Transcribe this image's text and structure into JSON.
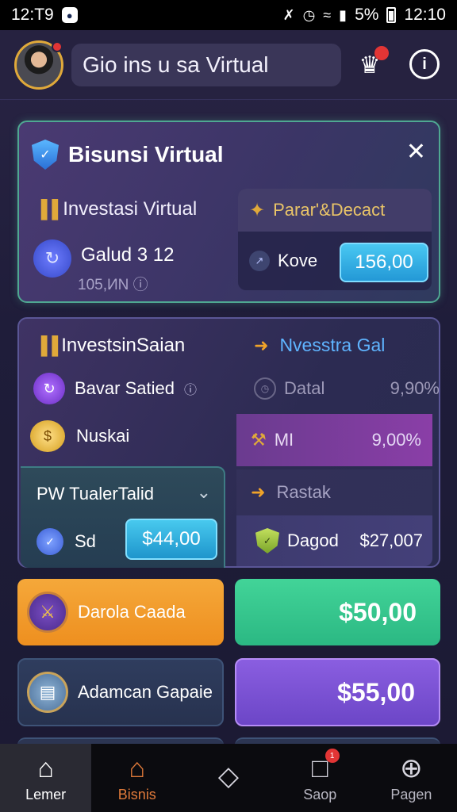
{
  "status_bar": {
    "left_time": "12:T9",
    "right_battery_pct": "5%",
    "right_time": "12:10"
  },
  "header": {
    "title": "Gio ins u sa Virtual",
    "icons": [
      "avatar",
      "trophy-icon",
      "info-icon"
    ]
  },
  "card1": {
    "title": "Bisunsi Virtual",
    "subtitle": "Investasi Virtual",
    "value_label": "Galud 3 12",
    "value_small": "105,ИN",
    "panel_title": "Parar'&Decact",
    "panel_row_label": "Kove",
    "panel_button": "156,00"
  },
  "card2": {
    "title_left": "InvestsinSaian",
    "title_right": "Nvesstra Gal",
    "row1_left": "Bavar Satied",
    "row1_right_label": "Datal",
    "row1_right_value": "9,90%",
    "row2_left": "Nuskai",
    "row2_right_label": "MI",
    "row2_right_value": "9,00%",
    "teal_title": "PW TualerTalid",
    "teal_row_label": "Sd",
    "teal_button": "$44,00",
    "row3_right_label": "Rastak",
    "row4_right_label": "Dagod",
    "row4_right_value": "$27,007"
  },
  "tiles": {
    "orange_label": "Darola Caada",
    "green_value": "$50,00",
    "navy_label": "Adamcan Gapaie",
    "violet_value": "$55,00"
  },
  "bottom_nav": [
    {
      "label": "Lemer",
      "icon": "home-icon"
    },
    {
      "label": "Bisnis",
      "icon": "business-home-icon"
    },
    {
      "label": "",
      "icon": "diamond-icon"
    },
    {
      "label": "Saop",
      "icon": "shop-icon",
      "badge": "1"
    },
    {
      "label": "Pagen",
      "icon": "add-icon"
    }
  ],
  "colors": {
    "accent_teal": "#4fa892",
    "button_blue": "#2398d6",
    "orange": "#ee8f1f",
    "green": "#2bb883",
    "violet": "#6c46c7",
    "badge_red": "#e23535"
  }
}
